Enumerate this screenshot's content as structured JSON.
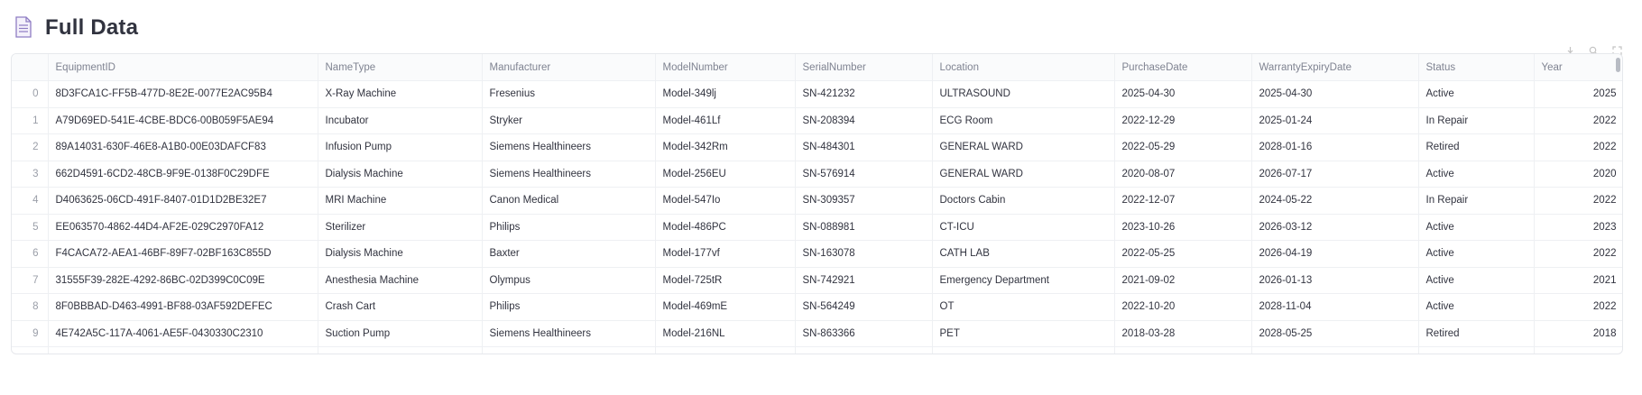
{
  "header": {
    "title": "Full Data",
    "icon": "document-icon"
  },
  "toolbar": {
    "icons": [
      "download-icon",
      "search-icon",
      "fullscreen-icon"
    ]
  },
  "table": {
    "columns": [
      "",
      "EquipmentID",
      "NameType",
      "Manufacturer",
      "ModelNumber",
      "SerialNumber",
      "Location",
      "PurchaseDate",
      "WarrantyExpiryDate",
      "Status",
      "Year"
    ],
    "rows": [
      [
        "0",
        "8D3FCA1C-FF5B-477D-8E2E-0077E2AC95B4",
        "X-Ray Machine",
        "Fresenius",
        "Model-349lj",
        "SN-421232",
        "ULTRASOUND",
        "2025-04-30",
        "2025-04-30",
        "Active",
        "2025"
      ],
      [
        "1",
        "A79D69ED-541E-4CBE-BDC6-00B059F5AE94",
        "Incubator",
        "Stryker",
        "Model-461Lf",
        "SN-208394",
        "ECG Room",
        "2022-12-29",
        "2025-01-24",
        "In Repair",
        "2022"
      ],
      [
        "2",
        "89A14031-630F-46E8-A1B0-00E03DAFCF83",
        "Infusion Pump",
        "Siemens Healthineers",
        "Model-342Rm",
        "SN-484301",
        "GENERAL WARD",
        "2022-05-29",
        "2028-01-16",
        "Retired",
        "2022"
      ],
      [
        "3",
        "662D4591-6CD2-48CB-9F9E-0138F0C29DFE",
        "Dialysis Machine",
        "Siemens Healthineers",
        "Model-256EU",
        "SN-576914",
        "GENERAL WARD",
        "2020-08-07",
        "2026-07-17",
        "Active",
        "2020"
      ],
      [
        "4",
        "D4063625-06CD-491F-8407-01D1D2BE32E7",
        "MRI Machine",
        "Canon Medical",
        "Model-547Io",
        "SN-309357",
        "Doctors Cabin",
        "2022-12-07",
        "2024-05-22",
        "In Repair",
        "2022"
      ],
      [
        "5",
        "EE063570-4862-44D4-AF2E-029C2970FA12",
        "Sterilizer",
        "Philips",
        "Model-486PC",
        "SN-088981",
        "CT-ICU",
        "2023-10-26",
        "2026-03-12",
        "Active",
        "2023"
      ],
      [
        "6",
        "F4CACA72-AEA1-46BF-89F7-02BF163C855D",
        "Dialysis Machine",
        "Baxter",
        "Model-177vf",
        "SN-163078",
        "CATH LAB",
        "2022-05-25",
        "2026-04-19",
        "Active",
        "2022"
      ],
      [
        "7",
        "31555F39-282E-4292-86BC-02D399C0C09E",
        "Anesthesia Machine",
        "Olympus",
        "Model-725tR",
        "SN-742921",
        "Emergency Department",
        "2021-09-02",
        "2026-01-13",
        "Active",
        "2021"
      ],
      [
        "8",
        "8F0BBBAD-D463-4991-BF88-03AF592DEFEC",
        "Crash Cart",
        "Philips",
        "Model-469mE",
        "SN-564249",
        "OT",
        "2022-10-20",
        "2028-11-04",
        "Active",
        "2022"
      ],
      [
        "9",
        "4E742A5C-117A-4061-AE5F-0430330C2310",
        "Suction Pump",
        "Siemens Healthineers",
        "Model-216NL",
        "SN-863366",
        "PET",
        "2018-03-28",
        "2028-05-25",
        "Retired",
        "2018"
      ]
    ]
  }
}
